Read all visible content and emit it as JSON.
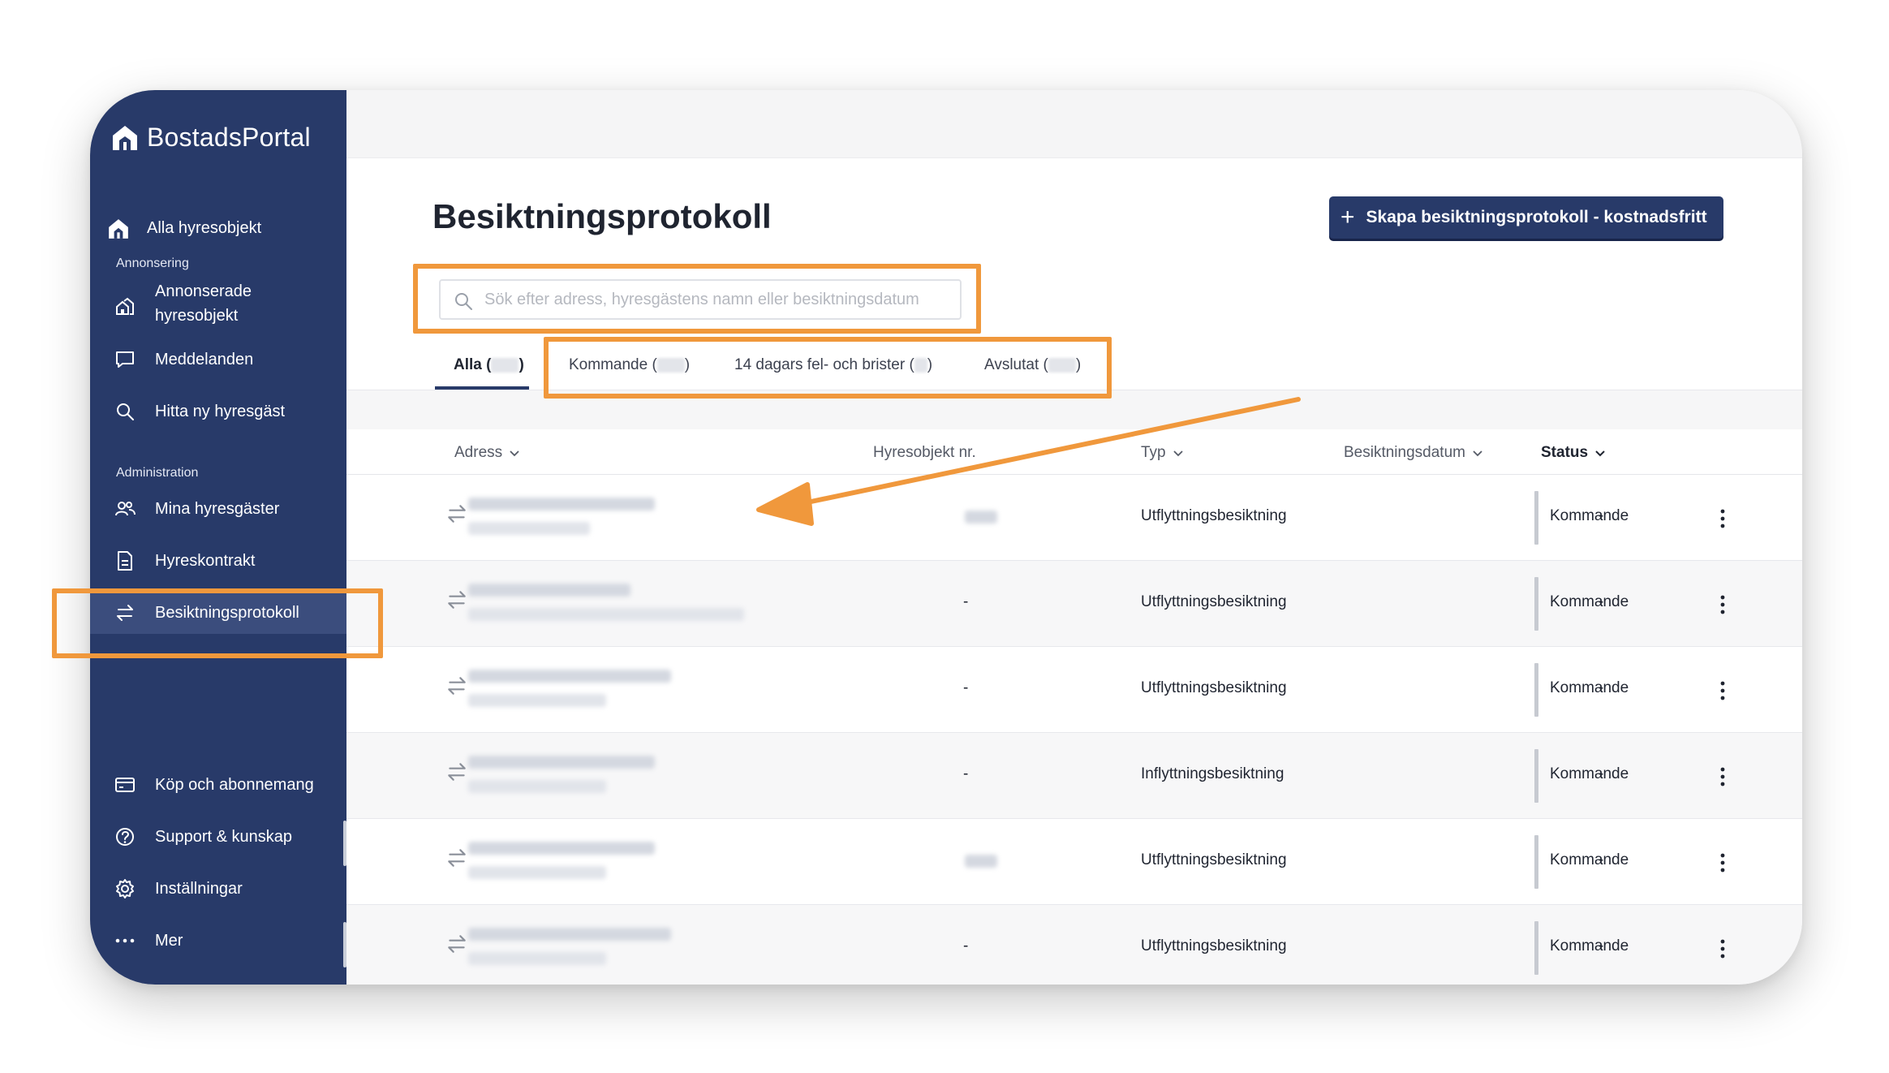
{
  "app": {
    "name": "BostadsPortal"
  },
  "sidebar": {
    "top_item": {
      "label": "Alla hyresobjekt",
      "icon": "home-icon"
    },
    "sections": [
      {
        "title": "Annonsering"
      },
      {
        "title": "Administration"
      }
    ],
    "items": [
      {
        "label": "Annonserade hyresobjekt",
        "line1": "Annonserade",
        "line2": "hyresobjekt",
        "icon": "homes-icon"
      },
      {
        "label": "Meddelanden",
        "icon": "chat-icon"
      },
      {
        "label": "Hitta ny hyresgäst",
        "icon": "search-icon"
      },
      {
        "label": "Mina hyresgäster",
        "icon": "users-icon"
      },
      {
        "label": "Hyreskontrakt",
        "icon": "document-icon"
      },
      {
        "label": "Besiktningsprotokoll",
        "icon": "swap-arrows-icon",
        "active": true
      }
    ],
    "bottom_items": [
      {
        "label": "Köp och abonnemang",
        "icon": "card-icon"
      },
      {
        "label": "Support & kunskap",
        "icon": "help-icon"
      },
      {
        "label": "Inställningar",
        "icon": "gear-icon"
      },
      {
        "label": "Mer",
        "icon": "more-dots-icon"
      }
    ]
  },
  "main": {
    "title": "Besiktningsprotokoll",
    "create_button": {
      "label": "Skapa besiktningsprotokoll - kostnadsfritt",
      "icon": "plus-icon"
    },
    "search": {
      "placeholder": "Sök efter adress, hyresgästens namn eller besiktningsdatum",
      "value": ""
    },
    "tabs": [
      {
        "label": "Alla (",
        "close": ")",
        "active": true
      },
      {
        "label": "Kommande (",
        "close": ")"
      },
      {
        "label": "14 dagars fel- och brister (",
        "close": ")"
      },
      {
        "label": "Avslutat (",
        "close": ")"
      }
    ],
    "columns": {
      "address": "Adress",
      "object_nr": "Hyresobjekt nr.",
      "type": "Typ",
      "date": "Besiktningsdatum",
      "status": "Status"
    },
    "rows": [
      {
        "object_nr": "",
        "type": "Utflyttningsbesiktning",
        "date": "-",
        "status": "Kommande"
      },
      {
        "object_nr": "-",
        "type": "Utflyttningsbesiktning",
        "date": "-",
        "status": "Kommande"
      },
      {
        "object_nr": "-",
        "type": "Utflyttningsbesiktning",
        "date": "-",
        "status": "Kommande"
      },
      {
        "object_nr": "-",
        "type": "Inflyttningsbesiktning",
        "date": "-",
        "status": "Kommande"
      },
      {
        "object_nr": "",
        "type": "Utflyttningsbesiktning",
        "date": "-",
        "status": "Kommande"
      },
      {
        "object_nr": "-",
        "type": "Utflyttningsbesiktning",
        "date": "-",
        "status": "Kommande"
      }
    ]
  },
  "colors": {
    "sidebar_bg": "#283a69",
    "sidebar_active": "#3b4d7d",
    "primary_button": "#283a69",
    "annotation": "#f0983c"
  }
}
